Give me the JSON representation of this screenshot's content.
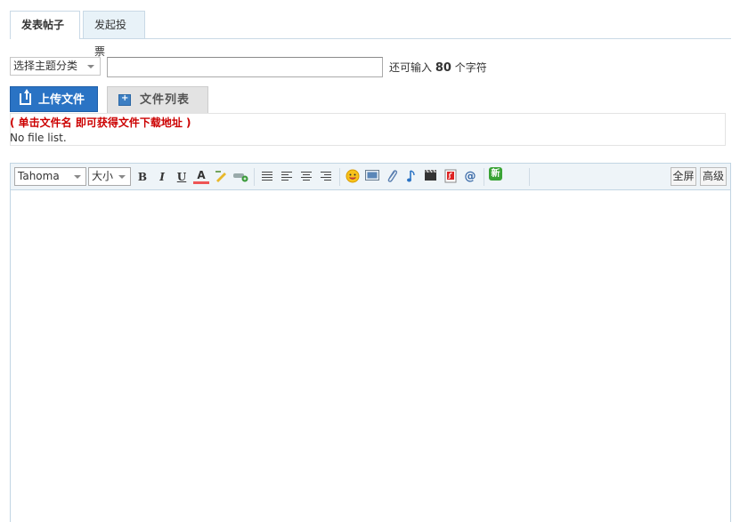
{
  "tabs": [
    {
      "label": "发表帖子",
      "active": true
    },
    {
      "label": "发起投票",
      "active": false
    }
  ],
  "subject": {
    "category_select": "选择主题分类",
    "title_value": "",
    "counter_prefix": "还可输入",
    "counter_value": "80",
    "counter_suffix": "个字符"
  },
  "attachments": {
    "upload_label": "上传文件",
    "filelist_label": "文件列表",
    "hint": "( 单击文件名 即可获得文件下载地址 )",
    "empty": "No file list."
  },
  "editor": {
    "font_family": "Tahoma",
    "font_size": "大小",
    "bold": "B",
    "italic": "I",
    "underline": "U",
    "font_color_icon": "A",
    "new_badge": "新",
    "fullscreen": "全屏",
    "advanced": "高级",
    "at_icon": "@",
    "content": ""
  },
  "colors": {
    "accent": "#2a73c4",
    "hint_red": "#cc0000",
    "toolbar_bg": "#eef4f8",
    "tab_border": "#c9d9e6"
  }
}
